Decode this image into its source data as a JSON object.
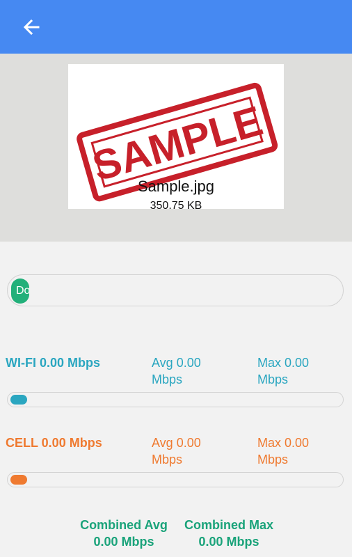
{
  "app_bar": {
    "back_icon": "arrow-left-icon",
    "color": "#4689f2"
  },
  "file": {
    "image_text": "SAMPLE",
    "name": "Sample.jpg",
    "size": "350.75 KB"
  },
  "main_progress": {
    "knob_text": "Do",
    "color": "#22b07a"
  },
  "wifi": {
    "label": "WI-FI 0.00 Mbps",
    "avg": "Avg 0.00 Mbps",
    "max": "Max 0.00 Mbps",
    "color": "#2aa6c0"
  },
  "cell": {
    "label": "CELL 0.00 Mbps",
    "avg": "Avg 0.00 Mbps",
    "max": "Max 0.00 Mbps",
    "color": "#ef7a30"
  },
  "combined": {
    "avg_label": "Combined Avg",
    "avg_value": "0.00 Mbps",
    "max_label": "Combined Max",
    "max_value": "0.00 Mbps",
    "color": "#1aa37a"
  }
}
